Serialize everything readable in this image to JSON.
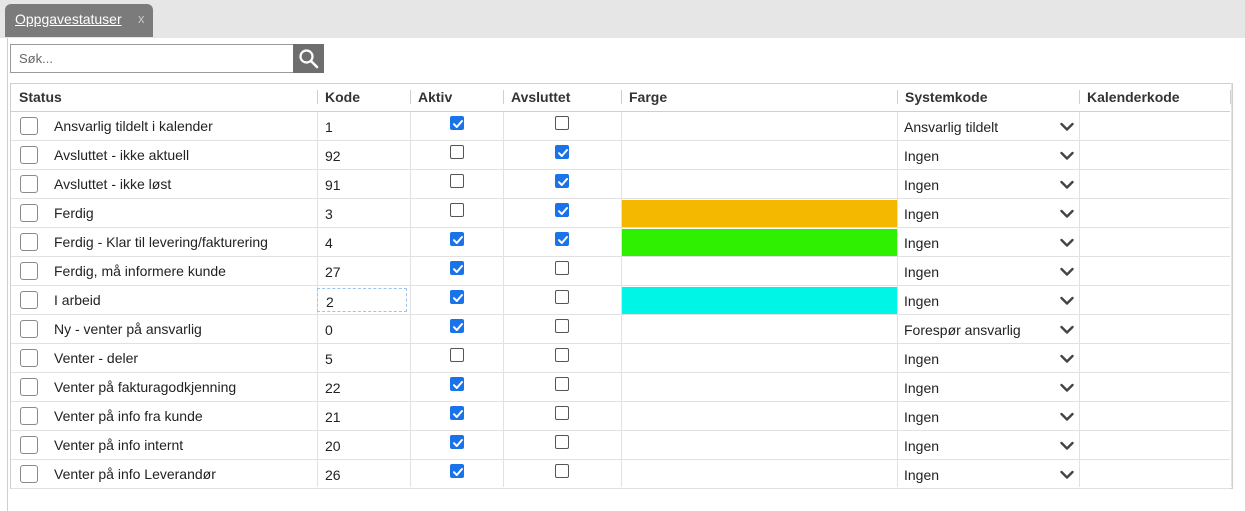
{
  "tab": {
    "label": "Oppgavestatuser",
    "close": "x"
  },
  "search": {
    "placeholder": "Søk..."
  },
  "columns": [
    "Status",
    "Kode",
    "Aktiv",
    "Avsluttet",
    "Farge",
    "Systemkode",
    "Kalenderkode"
  ],
  "rows": [
    {
      "name": "Ansvarlig tildelt i kalender",
      "kode": "1",
      "aktiv": true,
      "avsluttet": false,
      "farge": "",
      "systemkode": "Ansvarlig tildelt"
    },
    {
      "name": "Avsluttet - ikke aktuell",
      "kode": "92",
      "aktiv": false,
      "avsluttet": true,
      "farge": "",
      "systemkode": "Ingen"
    },
    {
      "name": "Avsluttet - ikke løst",
      "kode": "91",
      "aktiv": false,
      "avsluttet": true,
      "farge": "",
      "systemkode": "Ingen"
    },
    {
      "name": "Ferdig",
      "kode": "3",
      "aktiv": false,
      "avsluttet": true,
      "farge": "#f5b800",
      "systemkode": "Ingen"
    },
    {
      "name": "Ferdig - Klar til levering/fakturering",
      "kode": "4",
      "aktiv": true,
      "avsluttet": true,
      "farge": "#2ef000",
      "systemkode": "Ingen"
    },
    {
      "name": "Ferdig, må informere kunde",
      "kode": "27",
      "aktiv": true,
      "avsluttet": false,
      "farge": "",
      "systemkode": "Ingen"
    },
    {
      "name": "I arbeid",
      "kode": "2",
      "aktiv": true,
      "avsluttet": false,
      "farge": "#00f5e6",
      "systemkode": "Ingen",
      "editing": true
    },
    {
      "name": "Ny - venter på ansvarlig",
      "kode": "0",
      "aktiv": true,
      "avsluttet": false,
      "farge": "",
      "systemkode": "Forespør ansvarlig"
    },
    {
      "name": "Venter - deler",
      "kode": "5",
      "aktiv": false,
      "avsluttet": false,
      "farge": "",
      "systemkode": "Ingen"
    },
    {
      "name": "Venter på fakturagodkjenning",
      "kode": "22",
      "aktiv": true,
      "avsluttet": false,
      "farge": "",
      "systemkode": "Ingen"
    },
    {
      "name": "Venter på info fra kunde",
      "kode": "21",
      "aktiv": true,
      "avsluttet": false,
      "farge": "",
      "systemkode": "Ingen"
    },
    {
      "name": "Venter på info internt",
      "kode": "20",
      "aktiv": true,
      "avsluttet": false,
      "farge": "",
      "systemkode": "Ingen"
    },
    {
      "name": "Venter på info Leverandør",
      "kode": "26",
      "aktiv": true,
      "avsluttet": false,
      "farge": "",
      "systemkode": "Ingen"
    }
  ],
  "icons": {
    "search": "search-icon",
    "dropdown": "chevron-down-icon",
    "checkbox": "checkmark-icon"
  },
  "colors": {
    "checkbox_checked": "#1a73e8",
    "tab_bg": "#7b7b7b",
    "search_button_bg": "#6e6e6e"
  }
}
